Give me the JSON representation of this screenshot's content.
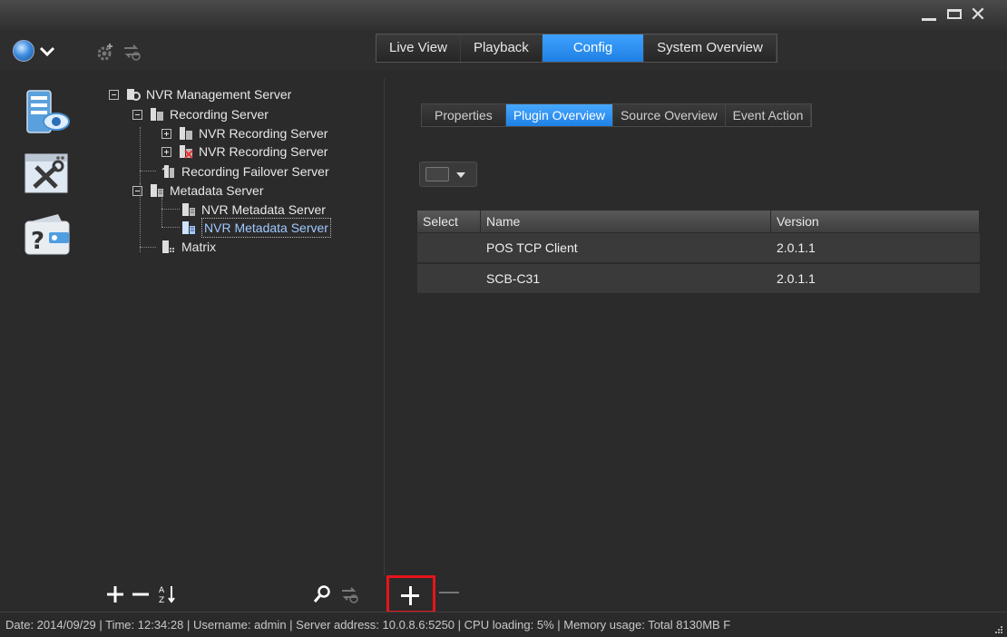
{
  "window": {
    "minimize_label": "_",
    "close_label": "✕"
  },
  "toolbar": {
    "icons": [
      "globe-icon",
      "chevron-down-icon",
      "gear-icon",
      "sync-icon"
    ]
  },
  "top_tabs": [
    {
      "label": "Live View",
      "active": false
    },
    {
      "label": "Playback",
      "active": false
    },
    {
      "label": "Config",
      "active": true
    },
    {
      "label": "System Overview",
      "active": false
    }
  ],
  "rail": {
    "icons": [
      "server-monitor-icon",
      "tools-icon",
      "help-wallet-icon"
    ]
  },
  "tree": {
    "nodes": [
      {
        "label": "NVR Management Server",
        "icon": "management-server-icon"
      },
      {
        "label": "Recording Server",
        "icon": "recording-server-icon"
      },
      {
        "label": "NVR Recording Server",
        "icon": "recording-server-icon"
      },
      {
        "label": "NVR Recording Server",
        "icon": "recording-server-error-icon"
      },
      {
        "label": "Recording Failover Server",
        "icon": "failover-server-icon"
      },
      {
        "label": "Metadata Server",
        "icon": "metadata-server-icon"
      },
      {
        "label": "NVR Metadata Server",
        "icon": "metadata-server-icon"
      },
      {
        "label": "NVR Metadata Server",
        "icon": "metadata-server-icon",
        "selected": true
      },
      {
        "label": "Matrix",
        "icon": "matrix-icon"
      }
    ],
    "tools": {
      "add_label": "+",
      "remove_label": "—",
      "sort_icon": "sort-az-icon",
      "search_icon": "search-icon",
      "sync_icon": "sync-icon"
    }
  },
  "sub_tabs": [
    {
      "label": "Properties",
      "active": false
    },
    {
      "label": "Plugin Overview",
      "active": true
    },
    {
      "label": "Source Overview",
      "active": false
    },
    {
      "label": "Event Action",
      "active": false
    }
  ],
  "grid": {
    "columns": [
      "Select",
      "Name",
      "Version"
    ],
    "rows": [
      {
        "select": "",
        "name": "POS TCP Client",
        "version": "2.0.1.1"
      },
      {
        "select": "",
        "name": "SCB-C31",
        "version": "2.0.1.1"
      }
    ]
  },
  "status": {
    "text": "Date: 2014/09/29  |  Time: 12:34:28  |  Username: admin  |  Server address: 10.0.8.6:5250  |  CPU loading: 5%  |  Memory usage: Total 8130MB  F"
  },
  "colors": {
    "accent": "#2b8ff0",
    "highlight": "#e8141a",
    "background": "#2b2b2b"
  }
}
